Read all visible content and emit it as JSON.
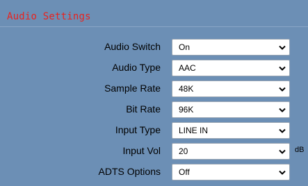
{
  "section": {
    "title": "Audio Settings"
  },
  "fields": [
    {
      "label": "Audio Switch",
      "value": "On",
      "icon": "chevron-down-icon"
    },
    {
      "label": "Audio Type",
      "value": "AAC",
      "icon": "chevron-down-icon"
    },
    {
      "label": "Sample Rate",
      "value": "48K",
      "icon": "chevron-down-icon"
    },
    {
      "label": "Bit Rate",
      "value": "96K",
      "icon": "chevron-down-icon"
    },
    {
      "label": "Input Type",
      "value": "LINE IN",
      "icon": "chevron-down-icon"
    },
    {
      "label": "Input Vol",
      "value": "20",
      "unit": "dB",
      "icon": "chevron-down-icon"
    },
    {
      "label": "ADTS Options",
      "value": "Off",
      "icon": "chevron-down-icon"
    }
  ],
  "colors": {
    "background": "#6c8fb5",
    "title": "#e8231f"
  }
}
